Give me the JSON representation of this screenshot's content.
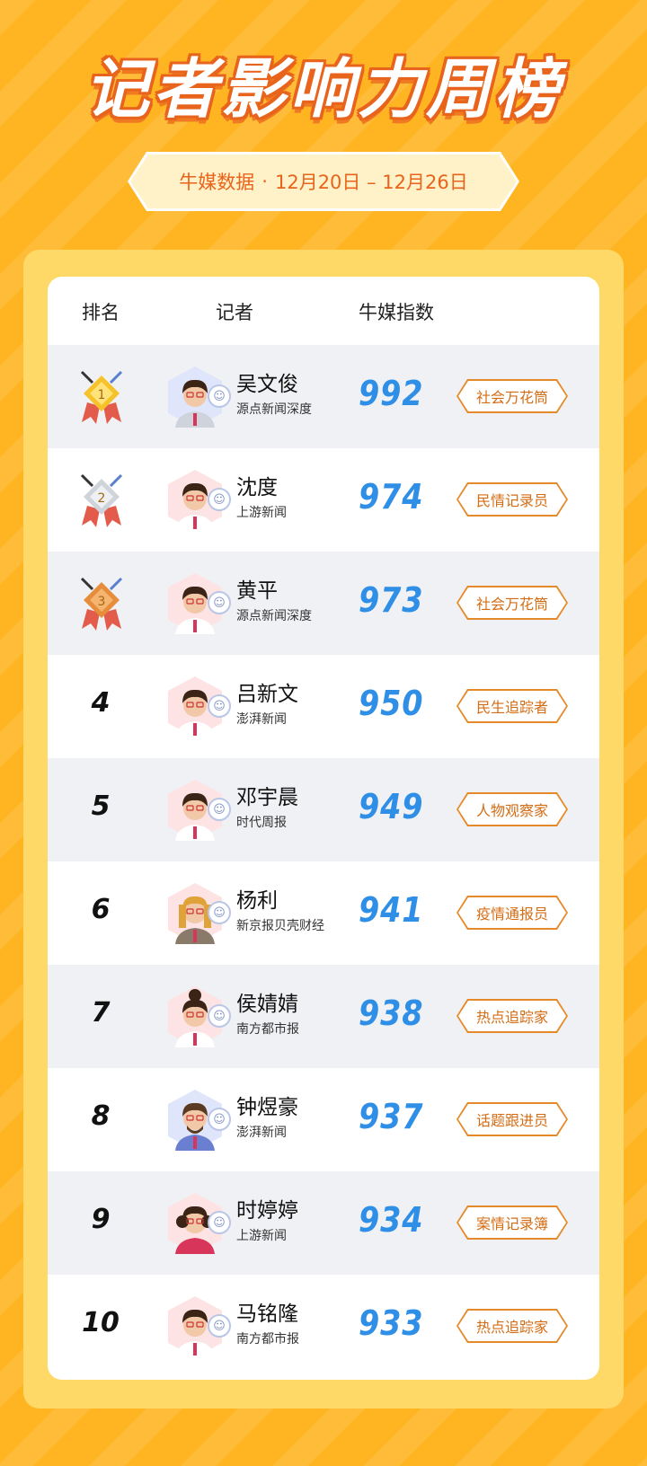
{
  "title": "记者影响力周榜",
  "subtitle": {
    "source": "牛媒数据",
    "separator": "·",
    "date_range": "12月20日 – 12月26日"
  },
  "table": {
    "headers": {
      "rank": "排名",
      "reporter": "记者",
      "index": "牛媒指数"
    },
    "rows": [
      {
        "rank": "1",
        "medal": "gold",
        "name": "吴文俊",
        "outlet": "源点新闻深度",
        "score": "992",
        "tag": "社会万花筒",
        "avatar": "male-avatar-blue"
      },
      {
        "rank": "2",
        "medal": "silver",
        "name": "沈度",
        "outlet": "上游新闻",
        "score": "974",
        "tag": "民情记录员",
        "avatar": "male-avatar-glasses"
      },
      {
        "rank": "3",
        "medal": "bronze",
        "name": "黄平",
        "outlet": "源点新闻深度",
        "score": "973",
        "tag": "社会万花筒",
        "avatar": "male-avatar-glasses"
      },
      {
        "rank": "4",
        "medal": "",
        "name": "吕新文",
        "outlet": "澎湃新闻",
        "score": "950",
        "tag": "民生追踪者",
        "avatar": "male-avatar-glasses"
      },
      {
        "rank": "5",
        "medal": "",
        "name": "邓宇晨",
        "outlet": "时代周报",
        "score": "949",
        "tag": "人物观察家",
        "avatar": "male-avatar-glasses"
      },
      {
        "rank": "6",
        "medal": "",
        "name": "杨利",
        "outlet": "新京报贝壳财经",
        "score": "941",
        "tag": "疫情通报员",
        "avatar": "female-avatar-blonde"
      },
      {
        "rank": "7",
        "medal": "",
        "name": "侯婧婧",
        "outlet": "南方都市报",
        "score": "938",
        "tag": "热点追踪家",
        "avatar": "female-avatar-bun"
      },
      {
        "rank": "8",
        "medal": "",
        "name": "钟煜豪",
        "outlet": "澎湃新闻",
        "score": "937",
        "tag": "话题跟进员",
        "avatar": "male-avatar-beard"
      },
      {
        "rank": "9",
        "medal": "",
        "name": "时婷婷",
        "outlet": "上游新闻",
        "score": "934",
        "tag": "案情记录簿",
        "avatar": "female-avatar-curly"
      },
      {
        "rank": "10",
        "medal": "",
        "name": "马铭隆",
        "outlet": "南方都市报",
        "score": "933",
        "tag": "热点追踪家",
        "avatar": "male-avatar-glasses"
      }
    ]
  },
  "colors": {
    "background": "#ffb422",
    "score": "#2f8fe6",
    "tag": "#d46c14",
    "title_outline": "#e8641c"
  }
}
